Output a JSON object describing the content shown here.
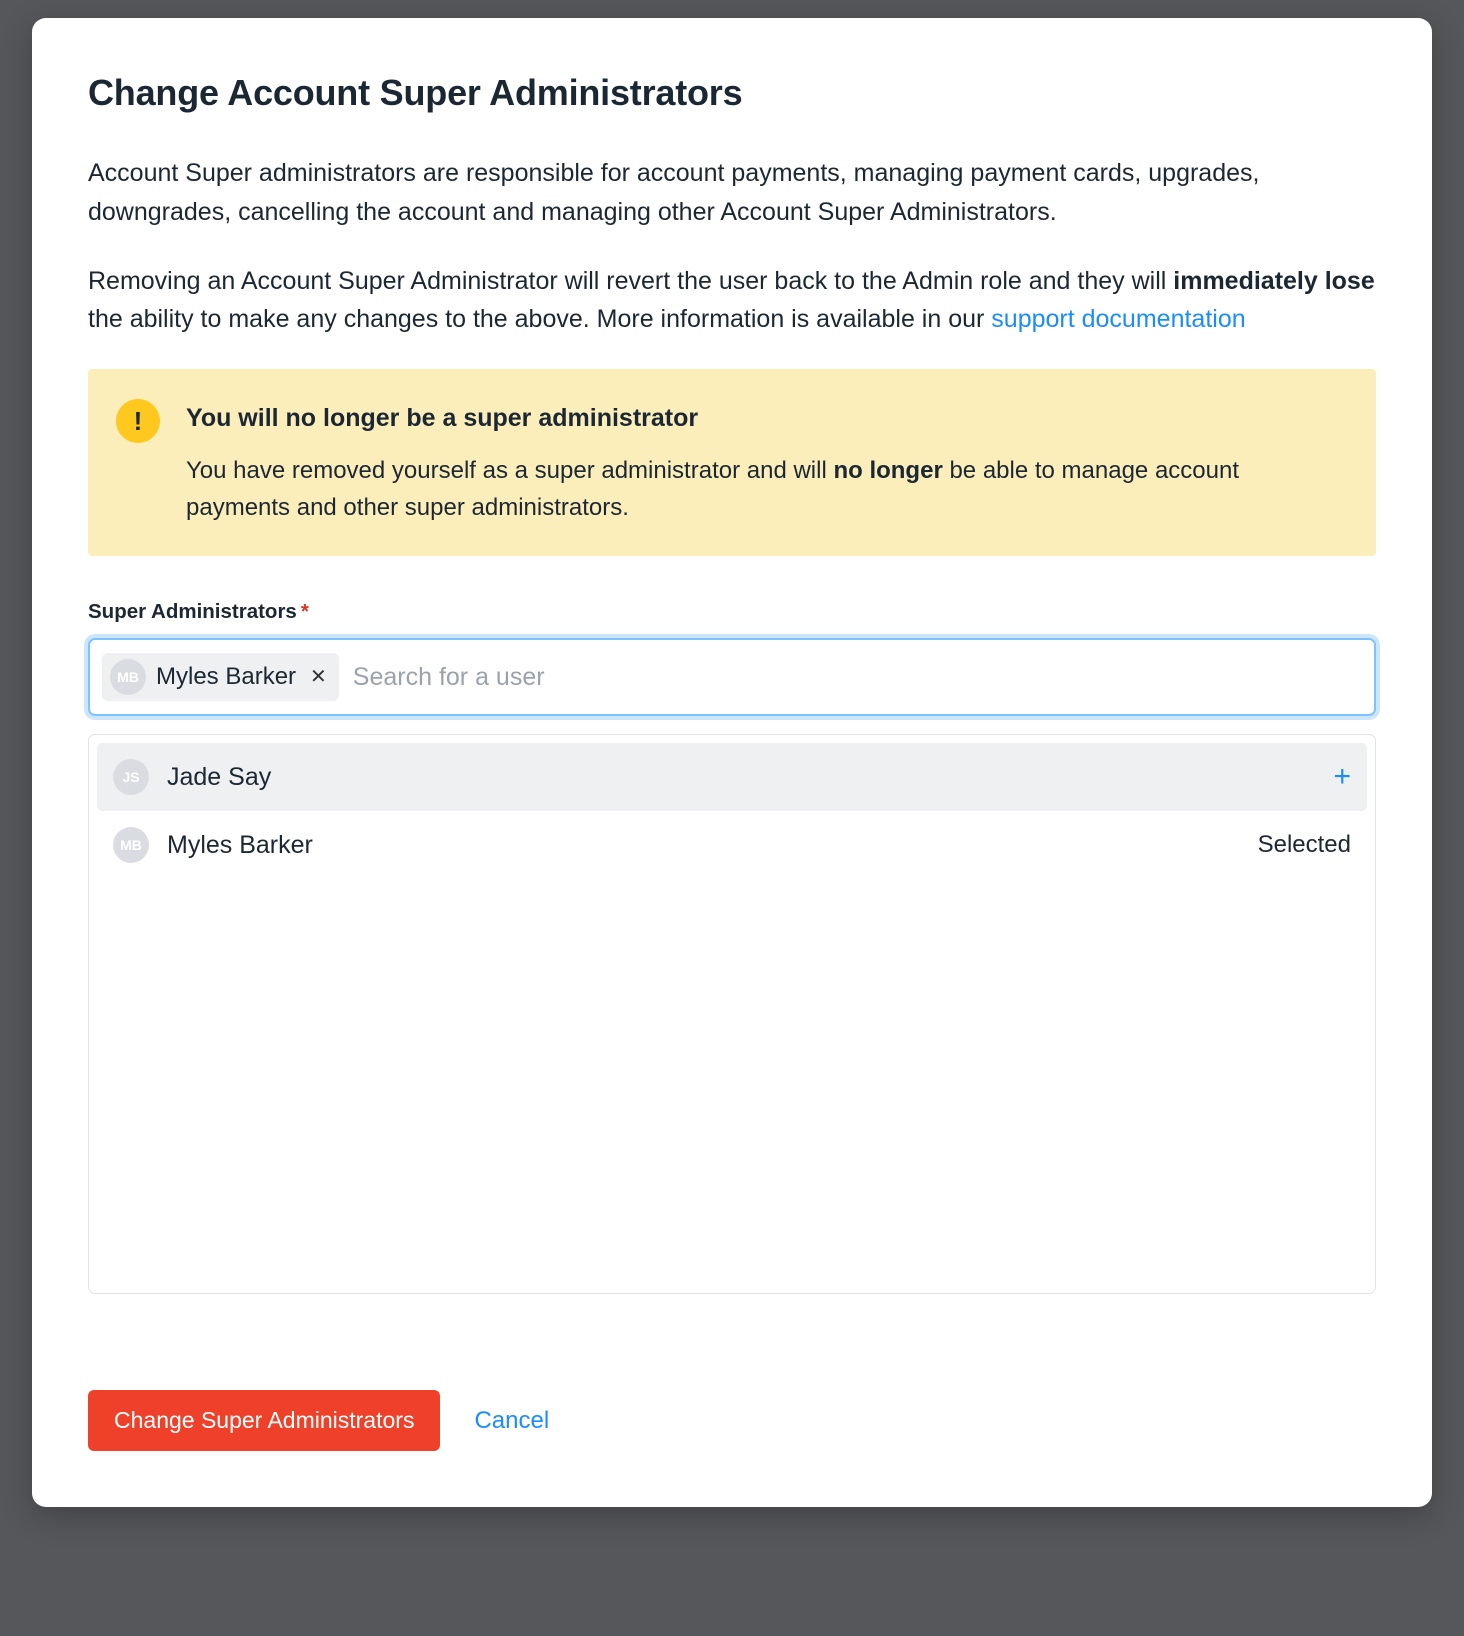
{
  "dialog": {
    "title": "Change Account Super Administrators",
    "paragraph1": "Account Super administrators are responsible for account payments, managing payment cards, upgrades, downgrades, cancelling the account and managing other Account Super Administrators.",
    "paragraph2_prefix": "Removing an Account Super Administrator will revert the user back to the Admin role and they will ",
    "paragraph2_strong": "immediately lose",
    "paragraph2_suffix": " the ability to make any changes to the above. More information is available in our ",
    "support_link_text": "support documentation"
  },
  "alert": {
    "title": "You will no longer be a super administrator",
    "body_prefix": "You have removed yourself as a super administrator and will ",
    "body_strong": "no longer",
    "body_suffix": " be able to manage account payments and other super administrators."
  },
  "field": {
    "label": "Super Administrators",
    "required_mark": "*",
    "search_placeholder": "Search for a user"
  },
  "selected_chips": [
    {
      "initials": "MB",
      "name": "Myles Barker"
    }
  ],
  "options": [
    {
      "initials": "JS",
      "name": "Jade Say",
      "state": "add",
      "highlighted": true
    },
    {
      "initials": "MB",
      "name": "Myles Barker",
      "state": "selected",
      "highlighted": false
    }
  ],
  "labels": {
    "selected_text": "Selected",
    "add_icon": "+"
  },
  "buttons": {
    "primary": "Change Super Administrators",
    "cancel": "Cancel"
  },
  "colors": {
    "accent_blue": "#1a8cff",
    "danger_red": "#ef4129",
    "alert_bg": "#fceeba",
    "alert_icon_bg": "#ffc81e"
  }
}
